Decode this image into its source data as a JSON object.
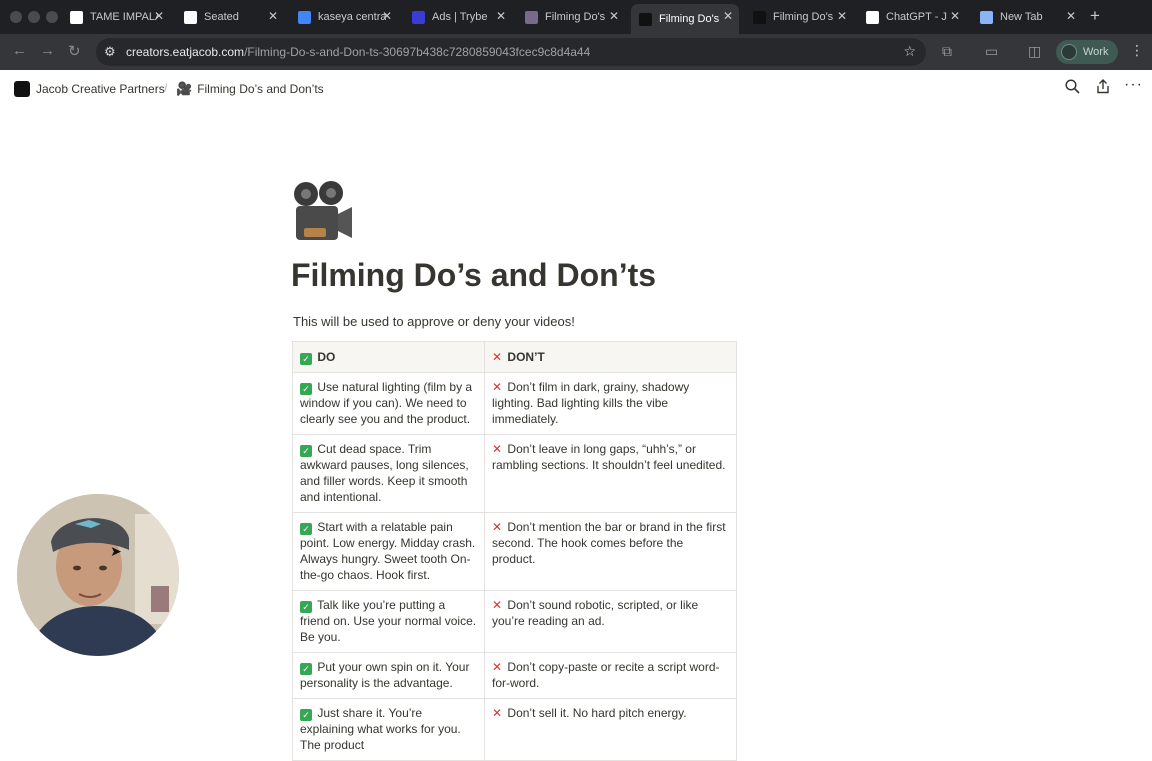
{
  "browser": {
    "tabs": [
      {
        "title": "TAME IMPALA",
        "favicon_color": "#ffffff"
      },
      {
        "title": "Seated",
        "favicon_color": "#ffffff"
      },
      {
        "title": "kaseya central",
        "favicon_color": "#4285f4"
      },
      {
        "title": "Ads | Trybe",
        "favicon_color": "#3b3bd6"
      },
      {
        "title": "Filming Do's",
        "favicon_color": "#7a6a8a"
      },
      {
        "title": "Filming Do's",
        "favicon_color": "#111111"
      },
      {
        "title": "Filming Do's",
        "favicon_color": "#111111"
      },
      {
        "title": "ChatGPT - J",
        "favicon_color": "#ffffff"
      },
      {
        "title": "New Tab",
        "favicon_color": "#8ab4f8"
      }
    ],
    "active_tab_index": 5,
    "url_domain": "creators.eatjacob.com",
    "url_path": "/Filming-Do-s-and-Don-ts-30697b438c7280859043fcec9c8d4a44",
    "profile_label": "Work"
  },
  "notion": {
    "workspace": "Jacob Creative Partners",
    "page_crumb": "Filming Do’s and Don’ts"
  },
  "page": {
    "icon": "movie-camera-icon",
    "title": "Filming Do’s and Don’ts",
    "subtitle": "This will be used to approve or deny your videos!",
    "table": {
      "headers": [
        "DO",
        "DON’T"
      ],
      "rows": [
        [
          "Use natural lighting (film by a window if you can). We need to clearly see you and the product.",
          "Don’t film in dark, grainy, shadowy lighting. Bad lighting kills the vibe immediately."
        ],
        [
          "Cut dead space. Trim awkward pauses, long silences, and filler words. Keep it smooth and intentional.",
          "Don’t leave in long gaps, “uhh’s,” or rambling sections. It shouldn’t feel unedited."
        ],
        [
          "Start with a relatable pain point. Low energy. Midday crash. Always hungry. Sweet tooth On-the-go chaos. Hook first.",
          "Don’t mention the bar or brand in the first second. The hook comes before the product."
        ],
        [
          "Talk like you’re putting a friend on. Use your normal voice. Be you.",
          "Don’t sound robotic, scripted, or like you’re reading an ad."
        ],
        [
          "Put your own spin on it. Your personality is the advantage.",
          "Don’t copy-paste or recite a script word-for-word."
        ],
        [
          "Just share it. You’re explaining what works for you. The product",
          "Don’t sell it. No hard pitch energy."
        ]
      ]
    }
  },
  "colors": {
    "do_check": "#34a853",
    "dont_cross": "#e03131",
    "header_bg": "#f7f6f3"
  }
}
